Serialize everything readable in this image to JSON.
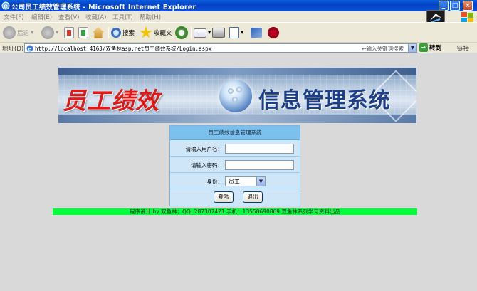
{
  "window": {
    "title": "公司员工绩效管理系统 - Microsoft Internet Explorer"
  },
  "menu": {
    "items": [
      {
        "label": "文件",
        "key": "(F)"
      },
      {
        "label": "编辑",
        "key": "(E)"
      },
      {
        "label": "查看",
        "key": "(V)"
      },
      {
        "label": "收藏",
        "key": "(A)"
      },
      {
        "label": "工具",
        "key": "(T)"
      },
      {
        "label": "帮助",
        "key": "(H)"
      }
    ]
  },
  "toolbar": {
    "back": "后退",
    "search": "搜索",
    "favorites": "收藏夹"
  },
  "address": {
    "label": "地址(D)",
    "url": "http://localhost:4163/双鱼林asp.net员工绩效系统/Login.aspx",
    "search_hint": "←输入关键词搜索",
    "go": "转到",
    "links": "链接"
  },
  "banner": {
    "red_text": "员工绩效",
    "blue_text": "信息管理系统"
  },
  "login": {
    "header": "员工绩效信息管理系统",
    "username_label": "请输入用户名：",
    "password_label": "请输入密码：",
    "role_label": "身份：",
    "role_value": "员工",
    "login_button": "登陆",
    "exit_button": "退出"
  },
  "footer": {
    "text": "程序设计 by 双鱼林；QQ: 287307421 手机：13558690869 双鱼林系列学习资料出品"
  },
  "colors": {
    "titlebar": "#0442c6",
    "footer_bg": "#00ff3c",
    "login_header": "#7cc0ee",
    "login_bg": "#cfe6f9",
    "banner_red": "#e01818",
    "banner_blue": "#1d3f8a"
  }
}
